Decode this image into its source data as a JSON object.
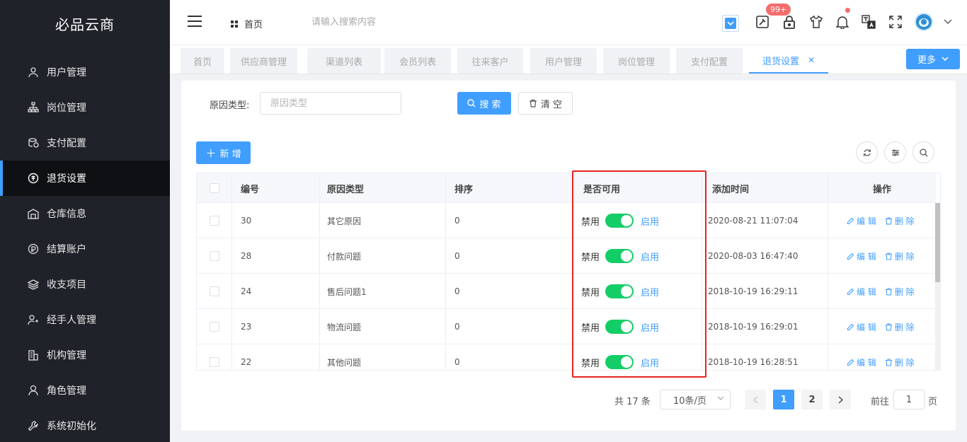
{
  "brand": "必品云商",
  "sidebar": {
    "items": [
      {
        "label": "用户管理",
        "icon": "user-icon",
        "active": false
      },
      {
        "label": "岗位管理",
        "icon": "org-chart-icon",
        "active": false
      },
      {
        "label": "支付配置",
        "icon": "coins-icon",
        "active": false
      },
      {
        "label": "退货设置",
        "icon": "return-icon",
        "active": true
      },
      {
        "label": "仓库信息",
        "icon": "warehouse-icon",
        "active": false
      },
      {
        "label": "结算账户",
        "icon": "account-icon",
        "active": false
      },
      {
        "label": "收支项目",
        "icon": "layers-icon",
        "active": false
      },
      {
        "label": "经手人管理",
        "icon": "user-add-icon",
        "active": false
      },
      {
        "label": "机构管理",
        "icon": "building-icon",
        "active": false
      },
      {
        "label": "角色管理",
        "icon": "role-icon",
        "active": false
      },
      {
        "label": "系统初始化",
        "icon": "wrench-icon",
        "active": false
      }
    ]
  },
  "header": {
    "breadcrumb": "首页",
    "search_placeholder": "请输入搜索内容",
    "badge": "99+"
  },
  "tabs": [
    {
      "label": "首页"
    },
    {
      "label": "供应商管理"
    },
    {
      "label": "渠道列表"
    },
    {
      "label": "会员列表"
    },
    {
      "label": "往来客户"
    },
    {
      "label": "用户管理"
    },
    {
      "label": "岗位管理"
    },
    {
      "label": "支付配置"
    },
    {
      "label": "退货设置",
      "active": true
    }
  ],
  "more_label": "更多",
  "filter": {
    "label": "原因类型:",
    "placeholder": "原因类型",
    "search_label": "搜 索",
    "clear_label": "清 空"
  },
  "add_label": "新 增",
  "table": {
    "columns": [
      "编号",
      "原因类型",
      "排序",
      "是否可用",
      "添加时间",
      "操作"
    ],
    "switch_off_label": "禁用",
    "switch_on_label": "启用",
    "edit_label": "编 辑",
    "delete_label": "删 除",
    "rows": [
      {
        "id": "30",
        "reason": "其它原因",
        "sort": "0",
        "enabled": true,
        "time": "2020-08-21 11:07:04"
      },
      {
        "id": "28",
        "reason": "付款问题",
        "sort": "0",
        "enabled": true,
        "time": "2020-08-03 16:47:40"
      },
      {
        "id": "24",
        "reason": "售后问题1",
        "sort": "0",
        "enabled": true,
        "time": "2018-10-19 16:29:11"
      },
      {
        "id": "23",
        "reason": "物流问题",
        "sort": "0",
        "enabled": true,
        "time": "2018-10-19 16:29:01"
      },
      {
        "id": "22",
        "reason": "其他问题",
        "sort": "0",
        "enabled": true,
        "time": "2018-10-19 16:28:51"
      }
    ]
  },
  "pagination": {
    "total": "共 17 条",
    "page_size": "10条/页",
    "pages": [
      "1",
      "2"
    ],
    "current": "1",
    "goto_label": "前往",
    "goto_value": "1",
    "goto_suffix": "页"
  },
  "colors": {
    "accent": "#409eff",
    "sidebar_bg": "#1f2229",
    "switch_on": "#13ce66",
    "highlight": "#e8231e",
    "badge": "#f56c6c"
  }
}
